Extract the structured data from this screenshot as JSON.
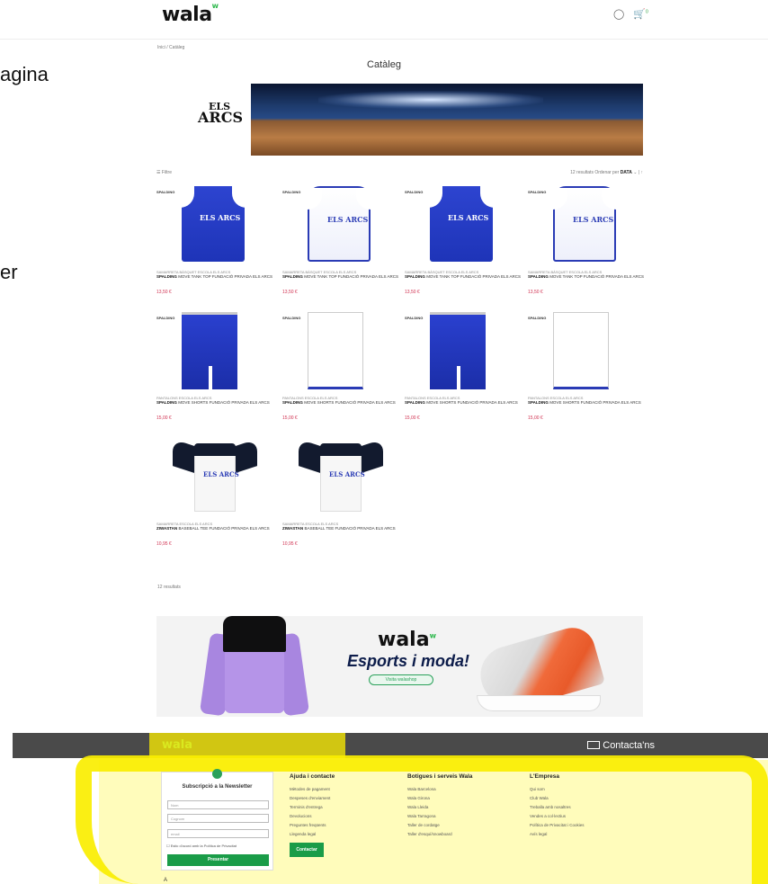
{
  "edge_text": [
    "agina",
    "er"
  ],
  "header": {
    "logo": "wala",
    "logo_mark": "w",
    "account_icon": "user-icon",
    "cart_icon": "cart-icon",
    "cart_count": "0"
  },
  "breadcrumb": "Inici  /  Catàleg",
  "page_title": "Catàleg",
  "hero": {
    "brand_top": "ELS",
    "brand_bottom": "ARCS"
  },
  "toolbar": {
    "filters": "Filtre",
    "results_text": "12 resultats  Ordenar per",
    "sort_value": "DATA"
  },
  "products": [
    {
      "cat": "SAMARRETA BÀSQUET ESCOLA ELS ARCS",
      "brand": "SPALDING",
      "name": "MOVE TANK TOP FUNDACIÓ PRIVADA ELS ARCS",
      "price": "13,50 €",
      "kind": "jersey",
      "color": "blue"
    },
    {
      "cat": "SAMARRETA BÀSQUET ESCOLA ELS ARCS",
      "brand": "SPALDING",
      "name": "MOVE TANK TOP FUNDACIÓ PRIVADA ELS ARCS",
      "price": "13,50 €",
      "kind": "jersey",
      "color": "white"
    },
    {
      "cat": "SAMARRETA BÀSQUET ESCOLA ELS ARCS",
      "brand": "SPALDING",
      "name": "MOVE TANK TOP FUNDACIÓ PRIVADA ELS ARCS",
      "price": "13,50 €",
      "kind": "jersey",
      "color": "blue"
    },
    {
      "cat": "SAMARRETA BÀSQUET ESCOLA ELS ARCS",
      "brand": "SPALDING",
      "name": "MOVE TANK TOP FUNDACIÓ PRIVADA ELS ARCS",
      "price": "13,50 €",
      "kind": "jersey",
      "color": "white"
    },
    {
      "cat": "PANTALONS ESCOLA ELS ARCS",
      "brand": "SPALDING",
      "name": "MOVE SHORTS FUNDACIÓ PRIVADA ELS ARCS",
      "price": "15,00 €",
      "kind": "shorts",
      "color": "blue"
    },
    {
      "cat": "PANTALONS ESCOLA ELS ARCS",
      "brand": "SPALDING",
      "name": "MOVE SHORTS FUNDACIÓ PRIVADA ELS ARCS",
      "price": "15,00 €",
      "kind": "shorts",
      "color": "white"
    },
    {
      "cat": "PANTALONS ESCOLA ELS ARCS",
      "brand": "SPALDING",
      "name": "MOVE SHORTS FUNDACIÓ PRIVADA ELS ARCS",
      "price": "15,00 €",
      "kind": "shorts",
      "color": "blue"
    },
    {
      "cat": "PANTALONS ESCOLA ELS ARCS",
      "brand": "SPALDING",
      "name": "MOVE SHORTS FUNDACIÓ PRIVADA ELS ARCS",
      "price": "15,00 €",
      "kind": "shorts",
      "color": "white"
    },
    {
      "cat": "SAMARRETA ESCOLA ELS ARCS",
      "brand": "ZIWASTAN",
      "name": "BASEBALL TEE FUNDACIÓ PRIVADA ELS ARCS",
      "price": "10,95 €",
      "kind": "tee",
      "color": "white"
    },
    {
      "cat": "SAMARRETA ESCOLA ELS ARCS",
      "brand": "ZIWASTAN",
      "name": "BASEBALL TEE FUNDACIÓ PRIVADA ELS ARCS",
      "price": "10,95 €",
      "kind": "tee",
      "color": "white"
    }
  ],
  "product_logo_text": "ELS ARCS",
  "product_tag": "SPALDING",
  "results_footer": "12 resultats",
  "promo": {
    "logo": "wala",
    "slogan": "Esports i moda!",
    "cta": "Visita walashop"
  },
  "footer": {
    "logo": "wala",
    "contact": "Contacta'ns",
    "newsletter": {
      "title": "Subscripció a la Newsletter",
      "ph_name": "Nom",
      "ph_surname": "Cognom",
      "ph_email": "email",
      "consent": "Estic d'acord amb la Política de Privacitat",
      "button": "Presentar"
    },
    "col1": {
      "title": "Ajuda i contacte",
      "links": [
        "Mètodes de pagament",
        "Despeses d'enviament",
        "Terminis d'entrega",
        "Devolucions",
        "Preguntes freqüents",
        "Llegenda legal"
      ],
      "button": "Contactar"
    },
    "col2": {
      "title": "Botigues i serveis Wala",
      "links": [
        "Wala Barcelona",
        "Wala Girona",
        "Wala Lleida",
        "Wala Tarragona",
        "Taller de cordatge",
        "Taller d'esquí/snowboard"
      ]
    },
    "col3": {
      "title": "L'Empresa",
      "links": [
        "Qui som",
        "Club Wala",
        "Treballa amb nosaltres",
        "Vendes a col·lectius",
        "Política de Privacitat i Cookies",
        "Avís legal"
      ]
    }
  },
  "bottom_scrap": "A"
}
